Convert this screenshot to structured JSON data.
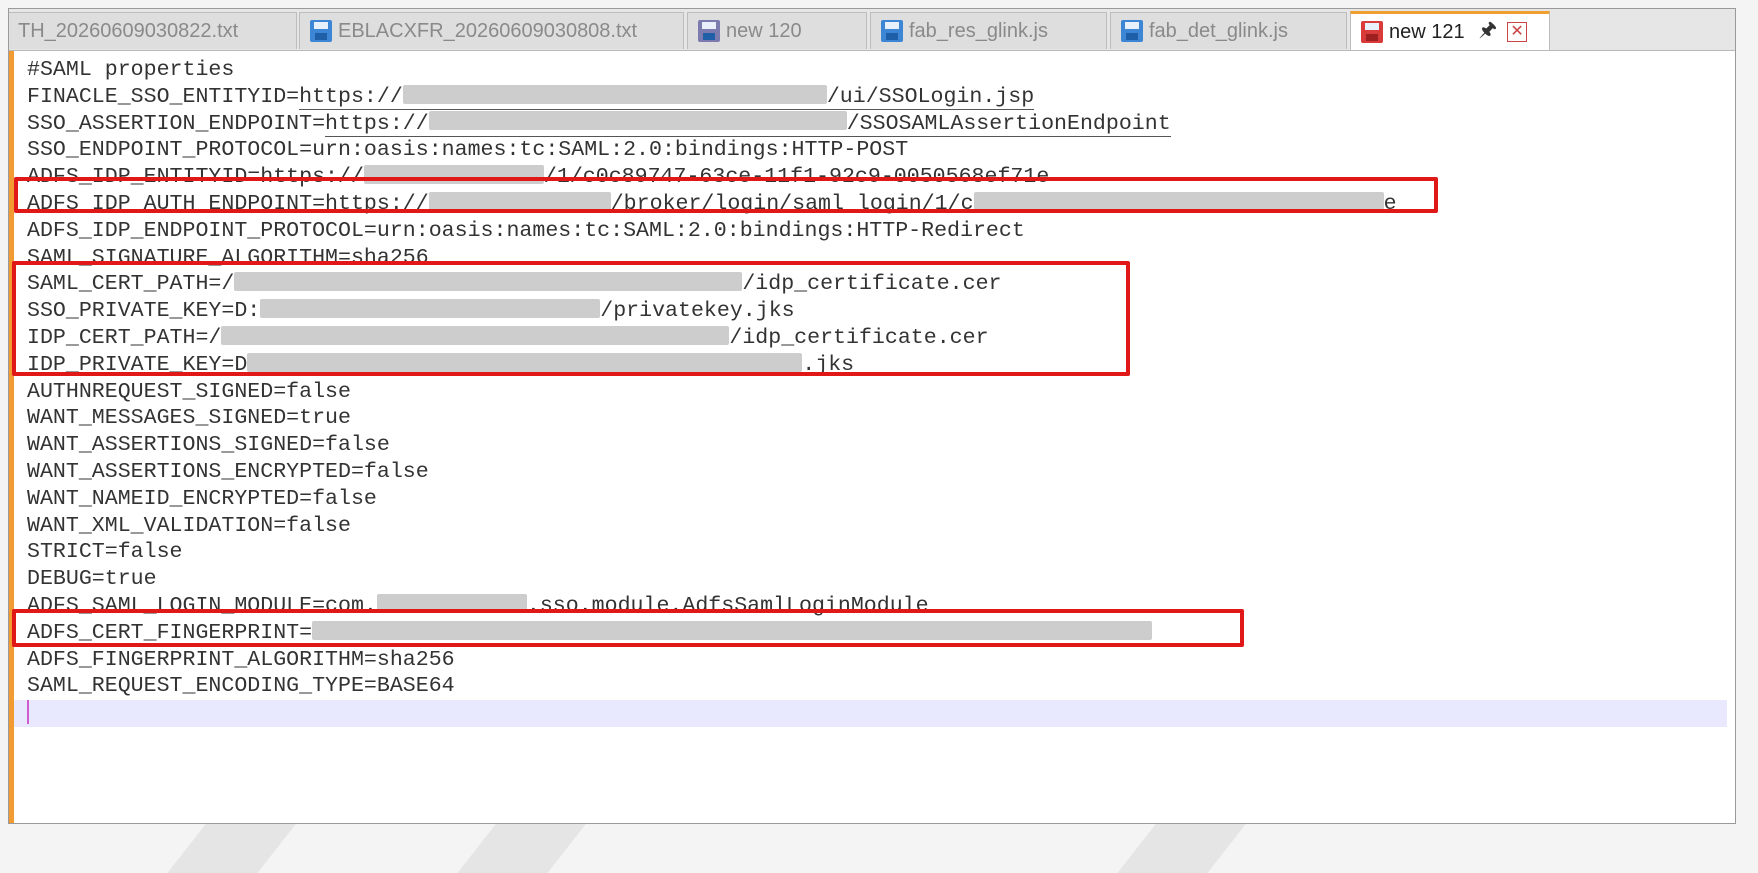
{
  "tabs": [
    {
      "label": "TH_20260609030822.txt",
      "icon": "none"
    },
    {
      "label": "EBLACXFR_20260609030808.txt",
      "icon": "save-blue-icon"
    },
    {
      "label": "new 120",
      "icon": "save-grey-icon"
    },
    {
      "label": "fab_res_glink.js",
      "icon": "save-blue-icon"
    },
    {
      "label": "fab_det_glink.js",
      "icon": "save-blue-icon"
    },
    {
      "label": "new 121",
      "icon": "save-red-icon",
      "active": true
    }
  ],
  "tab_icons": {
    "pin": "pin-icon",
    "close": "close-icon"
  },
  "colors": {
    "highlight": "#e01818",
    "active_tab_accent": "#f0a030",
    "gutter": "#f29b33"
  },
  "lines": [
    {
      "a": "#SAML properties"
    },
    {
      "a": "FINACLE_SSO_ENTITYID=",
      "b": "https://",
      "c": "/ui/SSOLogin.jsp"
    },
    {
      "a": "SSO_ASSERTION_ENDPOINT=",
      "b": "https://",
      "c": "/SSOSAMLAssertionEndpoint"
    },
    {
      "a": "SSO_ENDPOINT_PROTOCOL=urn:oasis:names:tc:SAML:2.0:bindings:HTTP-POST"
    },
    {
      "a": "ADFS_IDP_ENTITYID=https://",
      "c": "/1/c0c89747-63ce-11f1-92c9-0050568ef71e"
    },
    {
      "a": "ADFS_IDP_AUTH_ENDPOINT=https://",
      "c": "/broker/login/saml_login/1/c",
      "e": "e"
    },
    {
      "a": "ADFS_IDP_ENDPOINT_PROTOCOL=urn:oasis:names:tc:SAML:2.0:bindings:HTTP-Redirect"
    },
    {
      "a": "SAML_SIGNATURE_ALGORITHM=sha256"
    },
    {
      "a": "SAML_CERT_PATH=/",
      "c": "/idp_certificate.cer"
    },
    {
      "a": "SSO_PRIVATE_KEY=D:",
      "c": "/privatekey.jks"
    },
    {
      "a": "IDP_CERT_PATH=/",
      "c": "/idp_certificate.cer"
    },
    {
      "a": "IDP_PRIVATE_KEY=D",
      "c": ".jks"
    },
    {
      "a": "AUTHNREQUEST_SIGNED=false"
    },
    {
      "a": "WANT_MESSAGES_SIGNED=true"
    },
    {
      "a": "WANT_ASSERTIONS_SIGNED=false"
    },
    {
      "a": "WANT_ASSERTIONS_ENCRYPTED=false"
    },
    {
      "a": "WANT_NAMEID_ENCRYPTED=false"
    },
    {
      "a": "WANT_XML_VALIDATION=false"
    },
    {
      "a": "STRICT=false"
    },
    {
      "a": "DEBUG=true"
    },
    {
      "a": "ADFS_SAML_LOGIN_MODULE=com.",
      "c": ".sso.module.AdfsSamlLoginModule"
    },
    {
      "a": "ADFS_CERT_FINGERPRINT="
    },
    {
      "a": "ADFS_FINGERPRINT_ALGORITHM=sha256"
    },
    {
      "a": "SAML_REQUEST_ENCODING_TYPE=BASE64"
    },
    {
      "a": ""
    }
  ]
}
